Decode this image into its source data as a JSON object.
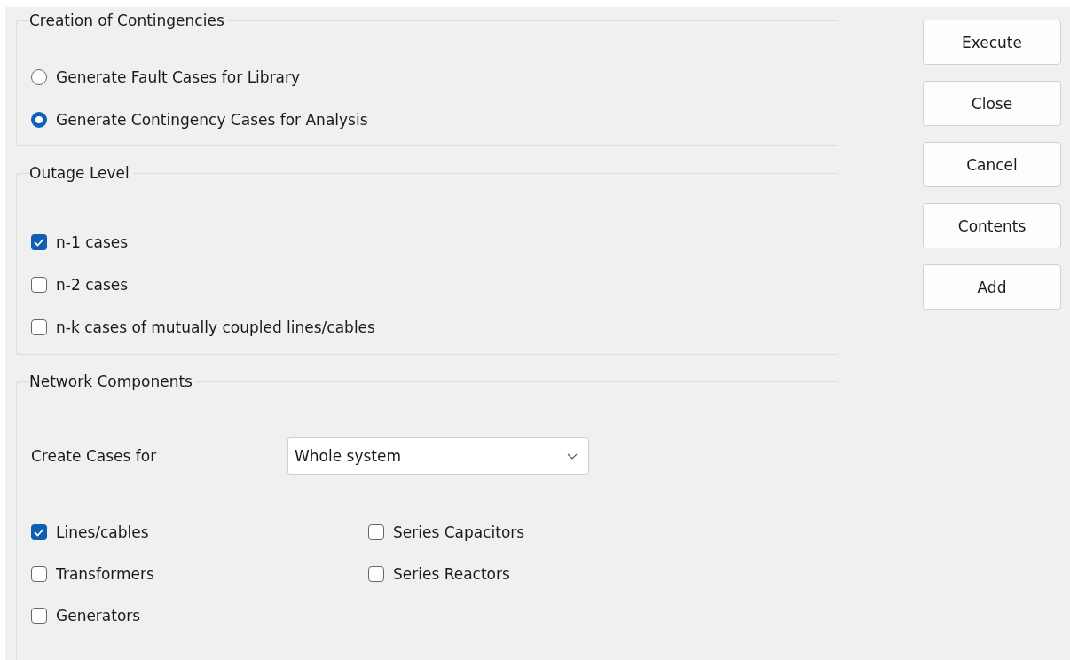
{
  "groups": [
    {
      "title": "Creation of Contingencies",
      "kind": "radio",
      "options": [
        {
          "label": "Generate Fault Cases for Library",
          "selected": false
        },
        {
          "label": "Generate Contingency Cases for Analysis",
          "selected": true
        }
      ]
    },
    {
      "title": "Outage Level",
      "kind": "checkbox",
      "options": [
        {
          "label": "n-1 cases",
          "checked": true
        },
        {
          "label": "n-2 cases",
          "checked": false
        },
        {
          "label": "n-k cases of mutually coupled lines/cables",
          "checked": false
        }
      ]
    },
    {
      "title": "Network Components",
      "kind": "checkgrid",
      "field": {
        "label": "Create Cases for",
        "value": "Whole system"
      },
      "options": [
        {
          "label": "Lines/cables",
          "checked": true
        },
        {
          "label": "Series Capacitors",
          "checked": false
        },
        {
          "label": "Transformers",
          "checked": false
        },
        {
          "label": "Series Reactors",
          "checked": false
        },
        {
          "label": "Generators",
          "checked": false
        }
      ]
    }
  ],
  "buttons": [
    "Execute",
    "Close",
    "Cancel",
    "Contents",
    "Add"
  ]
}
